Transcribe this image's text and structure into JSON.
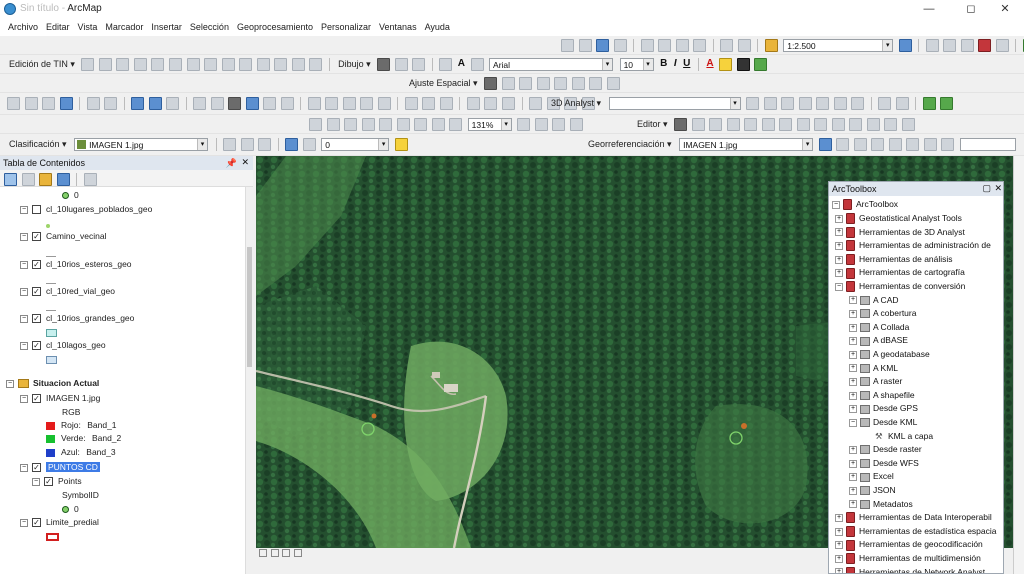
{
  "window": {
    "title": "ArcMap",
    "app_prefix": "Sin título - "
  },
  "menu": [
    "Archivo",
    "Editar",
    "Vista",
    "Marcador",
    "Insertar",
    "Selección",
    "Geoprocesamiento",
    "Personalizar",
    "Ventanas",
    "Ayuda"
  ],
  "toolbars": {
    "scale": "1:2.500",
    "tin_label": "Edición de TIN ▾",
    "draw_label": "Dibujo ▾",
    "font_name": "Arial",
    "font_size": "10",
    "spatial_adjust": "Ajuste Espacial ▾",
    "analyst3d": "3D Analyst ▾",
    "zoom_pct": "131%",
    "editor": "Editor ▾",
    "classification": "Clasificación ▾",
    "layer_combo": "IMAGEN 1.jpg",
    "transparency": "0",
    "georef_label": "Georreferenciación ▾",
    "georef_layer": "IMAGEN 1.jpg"
  },
  "toc": {
    "title": "Tabla de Contenidos",
    "items": [
      {
        "type": "legend",
        "symbol": "circle",
        "label": "0"
      },
      {
        "type": "layer",
        "label": "cl_10lugares_poblados_geo",
        "checked": false
      },
      {
        "type": "layer",
        "label": "Camino_vecinal",
        "checked": true
      },
      {
        "type": "layer",
        "label": "cl_10rios_esteros_geo",
        "checked": true
      },
      {
        "type": "layer",
        "label": "cl_10red_vial_geo",
        "checked": true
      },
      {
        "type": "layer",
        "label": "cl_10rios_grandes_geo",
        "checked": true
      },
      {
        "type": "layer",
        "label": "cl_10lagos_geo",
        "checked": true
      },
      {
        "type": "group",
        "label": "Situacion Actual"
      },
      {
        "type": "layer",
        "label": "IMAGEN 1.jpg",
        "checked": true
      },
      {
        "type": "text",
        "label": "RGB"
      },
      {
        "type": "band",
        "color": "#e41b1b",
        "label": "Rojo:",
        "value": "Band_1"
      },
      {
        "type": "band",
        "color": "#16c02f",
        "label": "Verde:",
        "value": "Band_2"
      },
      {
        "type": "band",
        "color": "#1f3fc9",
        "label": "Azul:",
        "value": "Band_3"
      },
      {
        "type": "layer",
        "label": "PUNTOS CD",
        "checked": true,
        "selected": true
      },
      {
        "type": "layer",
        "label": "Points",
        "checked": true
      },
      {
        "type": "text",
        "label": "SymbolID"
      },
      {
        "type": "legend",
        "symbol": "circle",
        "label": "0"
      },
      {
        "type": "layer",
        "label": "Limite_predial",
        "checked": true
      }
    ]
  },
  "arctoolbox": {
    "title": "ArcToolbox",
    "root": "ArcToolbox",
    "items": [
      {
        "label": "Geostatistical Analyst Tools",
        "level": 1,
        "kind": "box",
        "exp": "+"
      },
      {
        "label": "Herramientas de 3D Analyst",
        "level": 1,
        "kind": "box",
        "exp": "+"
      },
      {
        "label": "Herramientas de administración de",
        "level": 1,
        "kind": "box",
        "exp": "+"
      },
      {
        "label": "Herramientas de análisis",
        "level": 1,
        "kind": "box",
        "exp": "+"
      },
      {
        "label": "Herramientas de cartografía",
        "level": 1,
        "kind": "box",
        "exp": "+"
      },
      {
        "label": "Herramientas de conversión",
        "level": 1,
        "kind": "box",
        "exp": "−"
      },
      {
        "label": "A CAD",
        "level": 2,
        "kind": "set",
        "exp": "+"
      },
      {
        "label": "A cobertura",
        "level": 2,
        "kind": "set",
        "exp": "+"
      },
      {
        "label": "A Collada",
        "level": 2,
        "kind": "set",
        "exp": "+"
      },
      {
        "label": "A dBASE",
        "level": 2,
        "kind": "set",
        "exp": "+"
      },
      {
        "label": "A geodatabase",
        "level": 2,
        "kind": "set",
        "exp": "+"
      },
      {
        "label": "A KML",
        "level": 2,
        "kind": "set",
        "exp": "+"
      },
      {
        "label": "A raster",
        "level": 2,
        "kind": "set",
        "exp": "+"
      },
      {
        "label": "A shapefile",
        "level": 2,
        "kind": "set",
        "exp": "+"
      },
      {
        "label": "Desde GPS",
        "level": 2,
        "kind": "set",
        "exp": "+"
      },
      {
        "label": "Desde KML",
        "level": 2,
        "kind": "set",
        "exp": "−"
      },
      {
        "label": "KML a capa",
        "level": 3,
        "kind": "tool",
        "exp": ""
      },
      {
        "label": "Desde raster",
        "level": 2,
        "kind": "set",
        "exp": "+"
      },
      {
        "label": "Desde WFS",
        "level": 2,
        "kind": "set",
        "exp": "+"
      },
      {
        "label": "Excel",
        "level": 2,
        "kind": "set",
        "exp": "+"
      },
      {
        "label": "JSON",
        "level": 2,
        "kind": "set",
        "exp": "+"
      },
      {
        "label": "Metadatos",
        "level": 2,
        "kind": "set",
        "exp": "+"
      },
      {
        "label": "Herramientas de Data Interoperabil",
        "level": 1,
        "kind": "box",
        "exp": "+"
      },
      {
        "label": "Herramientas de estadística espacia",
        "level": 1,
        "kind": "box",
        "exp": "+"
      },
      {
        "label": "Herramientas de geocodificación",
        "level": 1,
        "kind": "box",
        "exp": "+"
      },
      {
        "label": "Herramientas de multidimensión",
        "level": 1,
        "kind": "box",
        "exp": "+"
      },
      {
        "label": "Herramientas de Network Analyst",
        "level": 1,
        "kind": "box",
        "exp": "+"
      }
    ]
  },
  "colors": {
    "selection": "#3d7be6",
    "toolbox_red": "#c3363b",
    "map_forest": "#1f4a2c",
    "map_clearing": "#6fae64"
  }
}
